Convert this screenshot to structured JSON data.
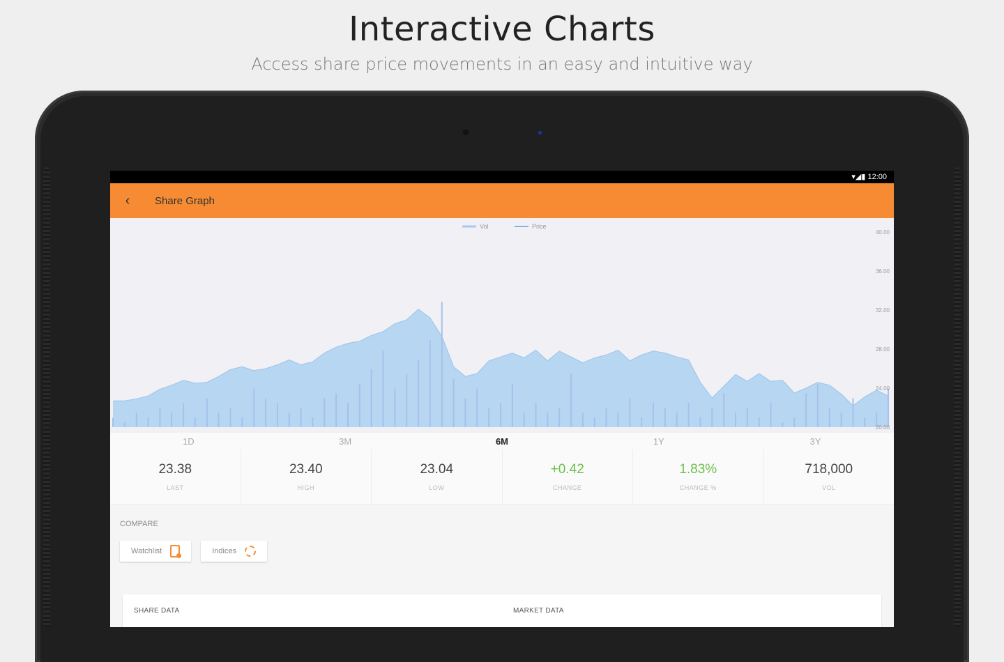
{
  "promo": {
    "title": "Interactive Charts",
    "subtitle": "Access share price movements in an easy and intuitive way"
  },
  "status_bar": {
    "time": "12:00",
    "icons": "▾◢▮"
  },
  "app_bar": {
    "back_icon": "chevron-left-icon",
    "title": "Share Graph",
    "accent": "#f68b33"
  },
  "chart_data": {
    "type": "area",
    "legend": [
      {
        "name": "Vol",
        "color": "#a8c8ee"
      },
      {
        "name": "Price",
        "color": "#5aa0e0"
      }
    ],
    "legend_placement": "top-center",
    "y_ticks": [
      "40.00",
      "36.00",
      "32.00",
      "28.00",
      "24.00",
      "20.00"
    ],
    "ylim": [
      20,
      40
    ],
    "price": [
      22.7,
      22.7,
      22.9,
      23.2,
      23.9,
      24.3,
      24.8,
      24.5,
      24.6,
      25.2,
      25.9,
      26.2,
      25.8,
      26.0,
      26.4,
      26.9,
      26.4,
      26.7,
      27.6,
      28.2,
      28.6,
      28.8,
      29.4,
      29.8,
      30.6,
      31.0,
      32.1,
      31.2,
      29.3,
      26.2,
      25.2,
      25.5,
      26.8,
      27.2,
      27.6,
      27.1,
      27.9,
      26.8,
      27.8,
      27.2,
      26.6,
      27.1,
      27.4,
      27.9,
      26.8,
      27.4,
      27.8,
      27.6,
      27.2,
      26.9,
      24.6,
      23.0,
      24.2,
      25.4,
      24.7,
      25.5,
      24.7,
      24.8,
      23.5,
      24.0,
      24.6,
      24.3,
      23.4,
      22.2,
      23.1,
      23.8,
      23.2
    ],
    "volume": [
      2,
      1,
      3,
      2,
      4,
      3,
      5,
      2,
      6,
      3,
      4,
      2,
      8,
      6,
      5,
      3,
      4,
      2,
      6,
      7,
      5,
      9,
      12,
      16,
      8,
      11,
      14,
      18,
      26,
      10,
      6,
      8,
      4,
      5,
      9,
      3,
      5,
      3,
      4,
      11,
      3,
      2,
      4,
      3,
      6,
      2,
      5,
      4,
      3,
      5,
      2,
      4,
      7,
      3,
      4,
      2,
      5,
      1,
      2,
      7,
      9,
      4,
      3,
      6,
      2,
      3,
      8
    ],
    "grid": false
  },
  "ranges": {
    "options": [
      "1D",
      "3M",
      "6M",
      "1Y",
      "3Y"
    ],
    "selected": "6M"
  },
  "stats": [
    {
      "value": "23.38",
      "label": "LAST",
      "color": "#444444"
    },
    {
      "value": "23.40",
      "label": "HIGH",
      "color": "#444444"
    },
    {
      "value": "23.04",
      "label": "LOW",
      "color": "#444444"
    },
    {
      "value": "+0.42",
      "label": "CHANGE",
      "color": "#6cbf4b"
    },
    {
      "value": "1.83%",
      "label": "CHANGE %",
      "color": "#6cbf4b"
    },
    {
      "value": "718,000",
      "label": "VOL",
      "color": "#444444"
    }
  ],
  "compare": {
    "label": "COMPARE",
    "watchlist_label": "Watchlist",
    "watchlist_icon": "watchlist-icon",
    "indices_label": "Indices",
    "indices_icon": "indices-icon"
  },
  "cards": {
    "share_data": "SHARE DATA",
    "market_data": "MARKET DATA"
  }
}
